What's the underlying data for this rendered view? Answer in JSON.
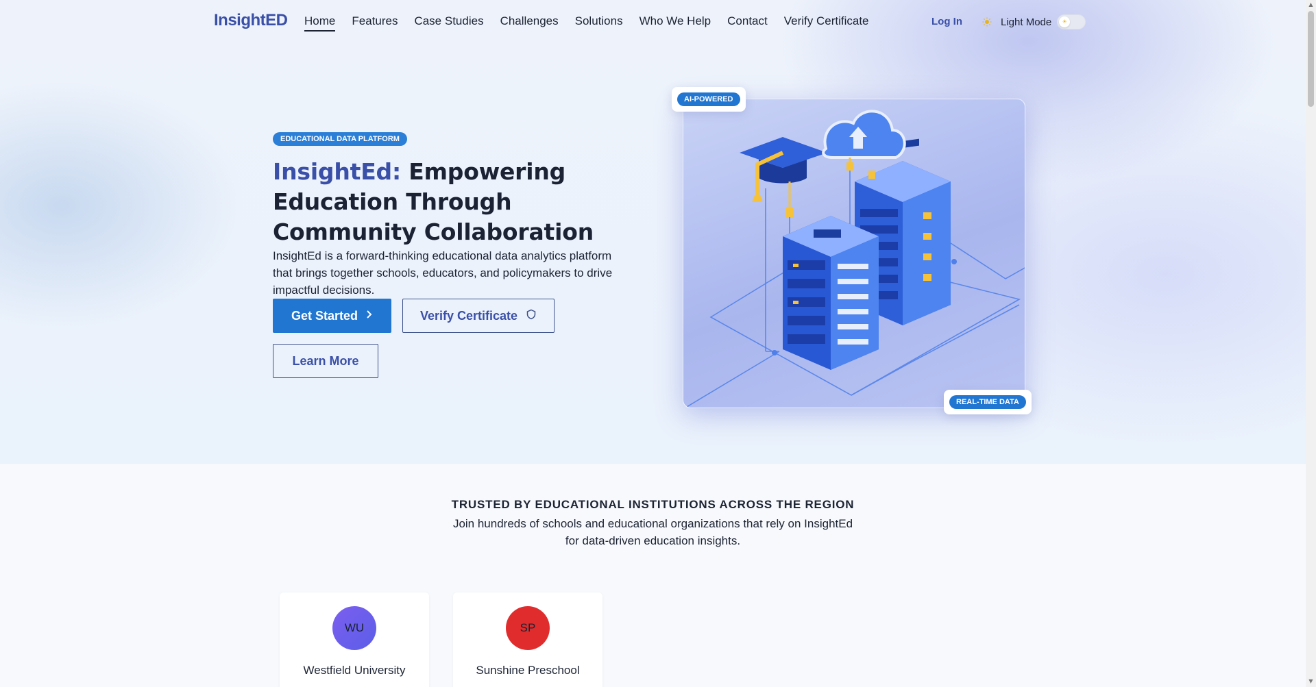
{
  "nav": {
    "logo": "InsightED",
    "links": [
      "Home",
      "Features",
      "Case Studies",
      "Challenges",
      "Solutions",
      "Who We Help",
      "Contact",
      "Verify Certificate"
    ],
    "login": "Log In",
    "mode_label": "Light Mode",
    "mode_icon": "sun-icon"
  },
  "hero": {
    "badge": "EDUCATIONAL DATA PLATFORM",
    "title_brand": "InsightEd:",
    "title_rest": " Empowering Education Through Community Collaboration",
    "description": "InsightEd is a forward-thinking educational data analytics platform that brings together schools, educators, and policymakers to drive impactful decisions.",
    "buttons": {
      "get_started": "Get Started",
      "verify": "Verify Certificate",
      "learn_more": "Learn More"
    },
    "tags": {
      "ai": "AI-POWERED",
      "realtime": "REAL-TIME DATA"
    }
  },
  "trusted": {
    "title": "TRUSTED BY EDUCATIONAL INSTITUTIONS ACROSS THE REGION",
    "description": "Join hundreds of schools and educational organizations that rely on InsightEd for data-driven education insights.",
    "institutions": [
      {
        "initials": "WU",
        "name": "Westfield University"
      },
      {
        "initials": "SP",
        "name": "Sunshine Preschool"
      }
    ]
  },
  "colors": {
    "brand": "#3a4fa8",
    "primary_button": "#2176d2",
    "pill": "#2b7fd6"
  }
}
